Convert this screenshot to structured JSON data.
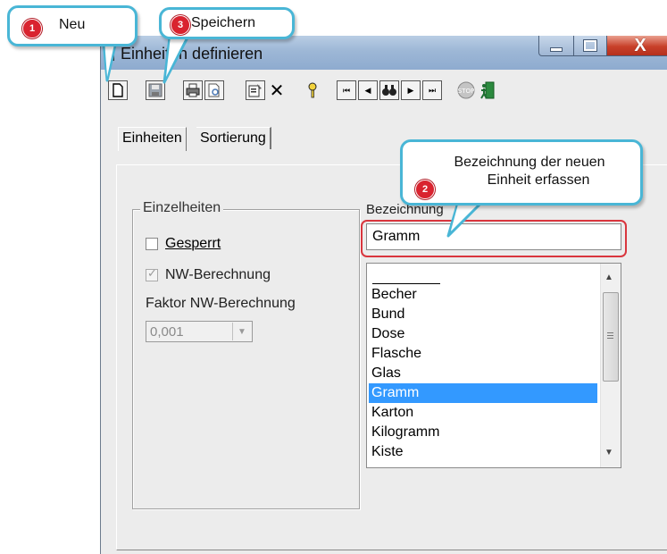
{
  "window": {
    "title": "Einheiten definieren",
    "buttons": {
      "minimize": "minimize",
      "maximize": "maximize",
      "close": "X"
    }
  },
  "toolbar": {
    "items": [
      {
        "name": "new-document-icon"
      },
      {
        "name": "save-icon"
      },
      {
        "name": "print-icon"
      },
      {
        "name": "print-preview-icon"
      },
      {
        "name": "properties-icon"
      },
      {
        "name": "delete-icon"
      },
      {
        "name": "key-icon"
      },
      {
        "name": "first-record-icon"
      },
      {
        "name": "previous-record-icon"
      },
      {
        "name": "search-binoculars-icon"
      },
      {
        "name": "next-record-icon"
      },
      {
        "name": "last-record-icon"
      },
      {
        "name": "stop-icon"
      },
      {
        "name": "exit-icon"
      }
    ]
  },
  "tabs": [
    {
      "label": "Einheiten",
      "active": true
    },
    {
      "label": "Sortierung",
      "active": false
    }
  ],
  "details": {
    "group_title": "Einzelheiten",
    "gesperrt_label": "Gesperrt",
    "gesperrt_checked": false,
    "nw_label": "NW-Berechnung",
    "nw_checked": true,
    "faktor_label": "Faktor NW-Berechnung",
    "faktor_value": "0,001"
  },
  "name_field": {
    "label": "Bezeichnung",
    "value": "Gramm"
  },
  "unit_list": {
    "items": [
      "",
      "Becher",
      "Bund",
      "Dose",
      "Flasche",
      "Glas",
      "Gramm",
      "Karton",
      "Kilogramm",
      "Kiste"
    ],
    "selected": "Gramm"
  },
  "callouts": {
    "neu": {
      "number": "1",
      "text": "Neu"
    },
    "erfassen": {
      "number": "2",
      "line1": "Bezeichnung der neuen",
      "line2": "Einheit erfassen"
    },
    "speichern": {
      "number": "3",
      "text": "Speichern"
    }
  },
  "colors": {
    "callout_border": "#49b6d6",
    "badge": "#d9232f",
    "highlight": "#d9363e",
    "selection": "#3399ff"
  }
}
